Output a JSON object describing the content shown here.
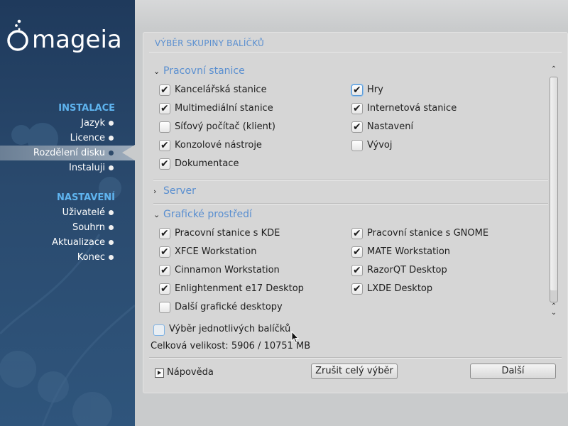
{
  "sidebar": {
    "logo_text": "mageia",
    "sections": [
      {
        "title": "INSTALACE",
        "items": [
          {
            "label": "Jazyk",
            "active": false
          },
          {
            "label": "Licence",
            "active": false
          },
          {
            "label": "Rozdělení disku",
            "active": true
          },
          {
            "label": "Instaluji",
            "active": false
          }
        ]
      },
      {
        "title": "NASTAVENÍ",
        "items": [
          {
            "label": "Uživatelé",
            "active": false
          },
          {
            "label": "Souhrn",
            "active": false
          },
          {
            "label": "Aktualizace",
            "active": false
          },
          {
            "label": "Konec",
            "active": false
          }
        ]
      }
    ]
  },
  "panel": {
    "title": "VÝBĚR SKUPINY BALÍČKŮ",
    "groups": [
      {
        "name": "Pracovní stanice",
        "expanded": true,
        "items": [
          {
            "label": "Kancelářská stanice",
            "checked": true
          },
          {
            "label": "Hry",
            "checked": true,
            "focused": true
          },
          {
            "label": "Multimediální stanice",
            "checked": true
          },
          {
            "label": "Internetová stanice",
            "checked": true
          },
          {
            "label": "Síťový počítač (klient)",
            "checked": false
          },
          {
            "label": "Nastavení",
            "checked": true
          },
          {
            "label": "Konzolové nástroje",
            "checked": true
          },
          {
            "label": "Vývoj",
            "checked": false
          },
          {
            "label": "Dokumentace",
            "checked": true
          }
        ]
      },
      {
        "name": "Server",
        "expanded": false,
        "items": []
      },
      {
        "name": "Grafické prostředí",
        "expanded": true,
        "items": [
          {
            "label": "Pracovní stanice s KDE",
            "checked": true
          },
          {
            "label": "Pracovní stanice s GNOME",
            "checked": true
          },
          {
            "label": "XFCE Workstation",
            "checked": true
          },
          {
            "label": "MATE Workstation",
            "checked": true
          },
          {
            "label": "Cinnamon Workstation",
            "checked": true
          },
          {
            "label": "RazorQT Desktop",
            "checked": true
          },
          {
            "label": "Enlightenment e17 Desktop",
            "checked": true
          },
          {
            "label": "LXDE Desktop",
            "checked": true
          },
          {
            "label": "Další grafické desktopy",
            "checked": false
          }
        ]
      }
    ],
    "individual_packages": {
      "label": "Výběr jednotlivých balíčků",
      "checked": false
    },
    "total_size": "Celková velikost: 5906 / 10751 MB",
    "help_label": "Nápověda",
    "unselect_all_label": "Zrušit celý výběr",
    "next_label": "Další"
  },
  "icons": {
    "expanded": "chevron-down-icon",
    "collapsed": "chevron-right-icon",
    "checkmark": "✔"
  },
  "colors": {
    "accent": "#5a8fd0",
    "sidebar_section": "#5fb4ef",
    "sidebar_bg": "#2a4a6e"
  }
}
